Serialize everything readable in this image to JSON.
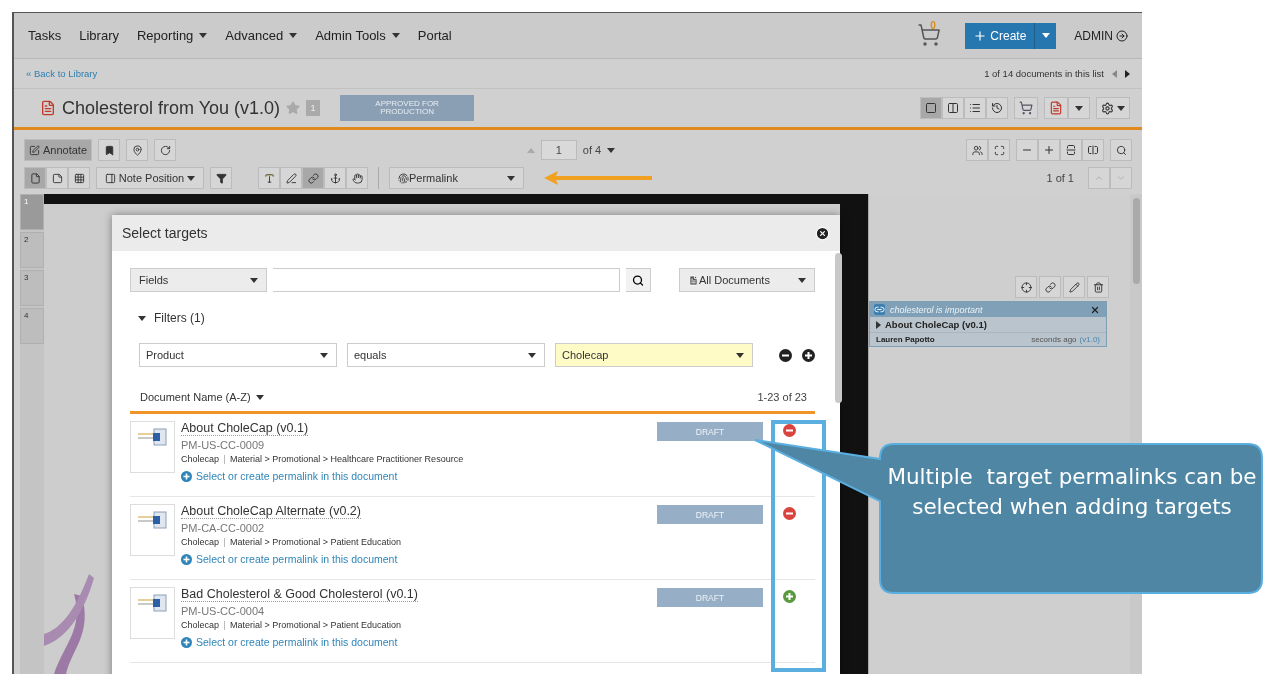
{
  "nav": {
    "items": [
      {
        "label": "Tasks",
        "dropdown": false
      },
      {
        "label": "Library",
        "dropdown": false
      },
      {
        "label": "Reporting",
        "dropdown": true
      },
      {
        "label": "Advanced",
        "dropdown": true
      },
      {
        "label": "Admin Tools",
        "dropdown": true
      },
      {
        "label": "Portal",
        "dropdown": false
      }
    ],
    "cart_count": "0",
    "create_label": "Create",
    "user": "ADMIN"
  },
  "subbar": {
    "back": "« Back to Library",
    "position": "1 of 14 documents in this list"
  },
  "document": {
    "title": "Cholesterol from You (v1.0)",
    "favorite": false,
    "version_badge": "1",
    "status": "APPROVED FOR PRODUCTION"
  },
  "view_modes": [
    {
      "kind": "full",
      "selected": true
    },
    {
      "kind": "split",
      "selected": false
    },
    {
      "kind": "list",
      "selected": false
    },
    {
      "kind": "history",
      "selected": false
    }
  ],
  "toolbar": {
    "annotate": "Annotate",
    "page": "1",
    "page_total": "of 4",
    "note_position": "Note Position",
    "permalink": "Permalink",
    "notes_page": "1 of 1"
  },
  "layout_modes": [
    {
      "kind": "page",
      "selected": true
    },
    {
      "kind": "notes",
      "selected": false
    },
    {
      "kind": "grid",
      "selected": false
    }
  ],
  "annotation_tools": [
    {
      "kind": "text",
      "selected": false
    },
    {
      "kind": "pen",
      "selected": false
    },
    {
      "kind": "link",
      "selected": true
    },
    {
      "kind": "anchor",
      "selected": false
    },
    {
      "kind": "hand",
      "selected": false
    }
  ],
  "thumbnails": [
    {
      "label": "1",
      "selected": true
    },
    {
      "label": "2",
      "selected": false
    },
    {
      "label": "3",
      "selected": false
    },
    {
      "label": "4",
      "selected": false
    }
  ],
  "modal": {
    "title": "Select targets",
    "search_scope": "Fields",
    "doc_scope": "All Documents",
    "filters_label": "Filters (1)",
    "filters_expanded": true,
    "filters": [
      {
        "field": "Product",
        "operator": "equals",
        "value": "Cholecap"
      }
    ],
    "sort": "Document Name (A-Z)",
    "range": "1-23 of 23",
    "documents": [
      {
        "name": "About CholeCap (v0.1)",
        "number": "PM-US-CC-0009",
        "product": "Cholecap",
        "path": "Material > Promotional > Healthcare Practitioner Resource",
        "link": "Select or create permalink in this document",
        "status": "DRAFT",
        "selected": true
      },
      {
        "name": "About CholeCap Alternate (v0.2)",
        "number": "PM-CA-CC-0002",
        "product": "Cholecap",
        "path": "Material > Promotional > Patient Education",
        "link": "Select or create permalink in this document",
        "status": "DRAFT",
        "selected": true
      },
      {
        "name": "Bad Cholesterol & Good Cholesterol (v0.1)",
        "number": "PM-US-CC-0004",
        "product": "Cholecap",
        "path": "Material > Promotional > Patient Education",
        "link": "Select or create permalink in this document",
        "status": "DRAFT",
        "selected": false
      }
    ]
  },
  "note": {
    "title": "cholesterol is important",
    "target": "About CholeCap (v0.1)",
    "author": "Lauren Papotto",
    "time": "seconds ago",
    "version": "(v1.0)"
  },
  "callout": {
    "text": "Multiple  target permalinks can be selected when adding targets"
  }
}
